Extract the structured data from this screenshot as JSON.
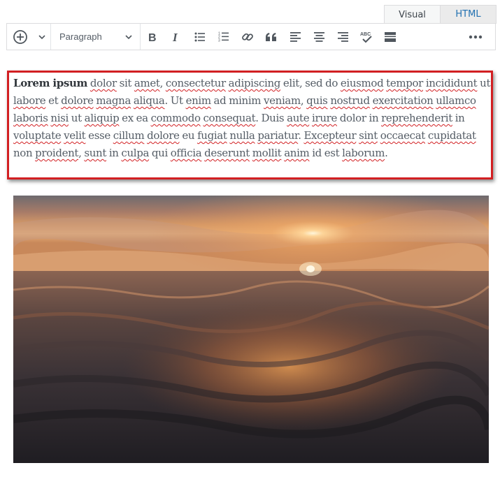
{
  "tabs": {
    "visual": "Visual",
    "html": "HTML",
    "active": "visual"
  },
  "toolbar": {
    "format_value": "Paragraph",
    "buttons": [
      "add-block",
      "bold",
      "italic",
      "bulleted-list",
      "numbered-list",
      "insert-link",
      "blockquote",
      "align-left",
      "align-center",
      "align-right",
      "spellcheck",
      "toolbar-toggle",
      "more-options"
    ]
  },
  "content": {
    "bold_lead": "Lorem ipsum",
    "words_1": [
      " ",
      "dolor",
      " sit ",
      "amet",
      ", ",
      "consectetur",
      " ",
      "adipiscing",
      " elit, sed do ",
      "eiusmod",
      " ",
      "tempor",
      " ",
      "incididunt",
      " ut ",
      "labore",
      " et ",
      "dolore",
      " ",
      "magna",
      " ",
      "aliqua",
      ". Ut ",
      "enim",
      " ad minim ",
      "veniam",
      ", ",
      "quis",
      " ",
      "nostrud",
      " ",
      "exercitation",
      " ",
      "ullamco",
      " ",
      "laboris",
      " ",
      "nisi",
      " ut ",
      "aliquip",
      " ex ea ",
      "commodo",
      " ",
      "consequat",
      ". Duis ",
      "aute",
      " ",
      "irure",
      " dolor in ",
      "reprehenderit",
      " in ",
      "voluptate",
      " ",
      "velit",
      " esse ",
      "cillum",
      " ",
      "dolore",
      " eu ",
      "fugiat",
      " ",
      "nulla",
      " ",
      "pariatur",
      ". ",
      "Excepteur",
      " ",
      "sint",
      " ",
      "occaecat",
      " ",
      "cupidatat",
      " non ",
      "proident",
      ", ",
      "sunt",
      " in ",
      "culpa",
      " qui ",
      "officia",
      " ",
      "deserunt",
      " ",
      "mollit",
      " ",
      "anim",
      " id est ",
      "laborum",
      "."
    ],
    "misspelled_flags": [
      0,
      1,
      0,
      1,
      0,
      1,
      0,
      1,
      0,
      1,
      0,
      1,
      0,
      1,
      0,
      1,
      0,
      1,
      0,
      1,
      0,
      1,
      0,
      1,
      0,
      1,
      0,
      1,
      0,
      1,
      0,
      1,
      0,
      1,
      0,
      1,
      0,
      1,
      0,
      1,
      0,
      1,
      0,
      1,
      0,
      1,
      0,
      1,
      0,
      1,
      0,
      1,
      0,
      1,
      0,
      1,
      0,
      1,
      0,
      1,
      0,
      1,
      0,
      1,
      0,
      1,
      0,
      1,
      0,
      1,
      0,
      1,
      0,
      1,
      0,
      1,
      0,
      1,
      0,
      1,
      0,
      1,
      0,
      1,
      0,
      1,
      0,
      1,
      0
    ],
    "highlight_color": "#d21f22"
  },
  "image": {
    "name": "sunset-over-ocean"
  }
}
